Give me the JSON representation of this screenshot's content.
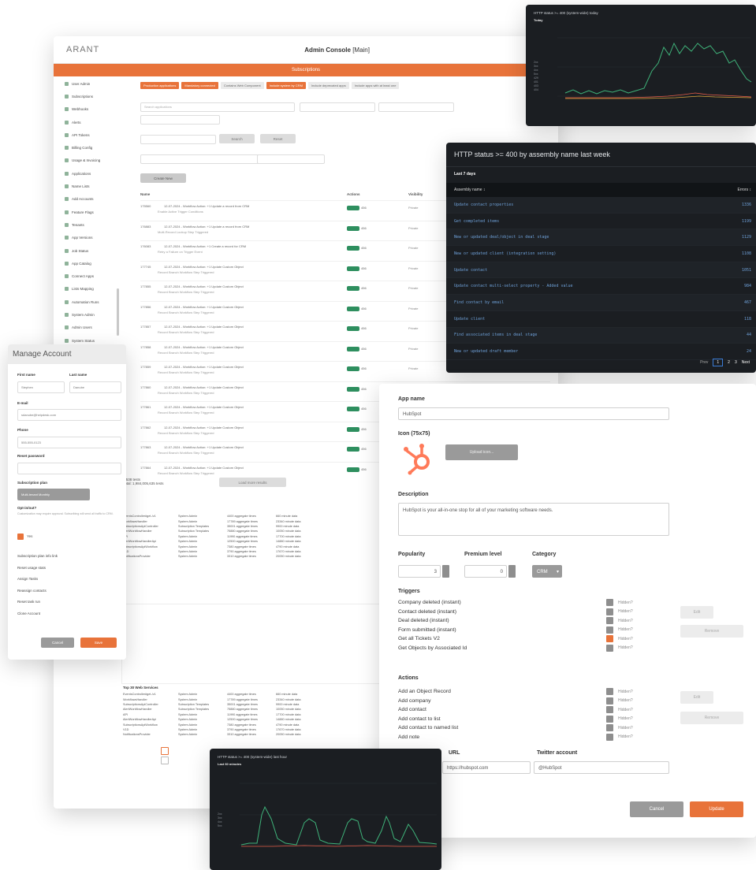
{
  "admin": {
    "brand": "ARANT",
    "title": "Admin Console",
    "title_suffix": "[Main]",
    "bar_label": "Subscriptions",
    "sidebar": [
      "User Admin",
      "Subscriptions",
      "Webhooks",
      "Alerts",
      "API Tokens",
      "Billing Config",
      "Usage & Invoicing",
      "Applications",
      "Name Lists",
      "Add Accounts",
      "Feature Flags",
      "Tenants",
      "App Versions",
      "Job Status",
      "App Catalog",
      "Connect Apps",
      "Lists Mapping",
      "Automation Runs",
      "System Admin",
      "Admin Users",
      "System Status"
    ],
    "chips": [
      "Production applications",
      "Mandatory connected",
      "Contains Web Component",
      "Include system by CRM",
      "Include deprecated apps",
      "Include apps with at least one"
    ],
    "search_placeholder": "Search applications",
    "buttons": {
      "search": "Search",
      "reset": "Reset",
      "create": "Create New"
    },
    "grid_headers": [
      "Name",
      "Actions",
      "Visibility"
    ],
    "rows": [
      {
        "t1": "175560",
        "t2": "12-07-2024 - Workflow Action: +1 Update a record from CRM",
        "t3": "Enable Active Trigger Conditions",
        "count": "456",
        "vis": "Private"
      },
      {
        "t1": "176883",
        "t2": "12-07-2024 - Workflow Action: +1 Update a record from CRM",
        "t3": "Multi-Record Lookup Step Triggered",
        "count": "456",
        "vis": "Private"
      },
      {
        "t1": "176083",
        "t2": "12-07-2024 - Workflow Action: +1 Create a record for CRM",
        "t3": "Retry a Failure on Trigger Event",
        "count": "456",
        "vis": "Private"
      },
      {
        "t1": "177745",
        "t2": "12-07-2024 - Workflow Action: +1 Update Custom Object",
        "t3": "Record Branch Workflow Step Triggered",
        "count": "456",
        "vis": "Private"
      },
      {
        "t1": "177855",
        "t2": "12-07-2024 - Workflow Action: +1 Update Custom Object",
        "t3": "Record Branch Workflow Step Triggered",
        "count": "456",
        "vis": "Private"
      },
      {
        "t1": "177856",
        "t2": "12-07-2024 - Workflow Action: +1 Update Custom Object",
        "t3": "Record Branch Workflow Step Triggered",
        "count": "456",
        "vis": "Private"
      },
      {
        "t1": "177857",
        "t2": "12-07-2024 - Workflow Action: +1 Update Custom Object",
        "t3": "Record Branch Workflow Step Triggered",
        "count": "456",
        "vis": "Private"
      },
      {
        "t1": "177858",
        "t2": "12-07-2024 - Workflow Action: +1 Update Custom Object",
        "t3": "Record Branch Workflow Step Triggered",
        "count": "456",
        "vis": "Private"
      },
      {
        "t1": "177859",
        "t2": "12-07-2024 - Workflow Action: +1 Update Custom Object",
        "t3": "Record Branch Workflow Step Triggered",
        "count": "456",
        "vis": "Private"
      },
      {
        "t1": "177860",
        "t2": "12-07-2024 - Workflow Action: +1 Update Custom Object",
        "t3": "Record Branch Workflow Step Triggered",
        "count": "456",
        "vis": "Private"
      },
      {
        "t1": "177861",
        "t2": "12-07-2024 - Workflow Action: +1 Update Custom Object",
        "t3": "Record Branch Workflow Step Triggered",
        "count": "456",
        "vis": "Private"
      },
      {
        "t1": "177862",
        "t2": "12-07-2024 - Workflow Action: +1 Update Custom Object",
        "t3": "Record Branch Workflow Step Triggered",
        "count": "456",
        "vis": "Private"
      },
      {
        "t1": "177863",
        "t2": "12-07-2024 - Workflow Action: +1 Update Custom Object",
        "t3": "Record Branch Workflow Step Triggered",
        "count": "456",
        "vis": "Private"
      },
      {
        "t1": "177864",
        "t2": "12-07-2024 - Workflow Action: +1 Update Custom Object",
        "t3": "Record Branch Workflow Step Triggered",
        "count": "456",
        "vis": "Private"
      }
    ],
    "stats_line1": "2,538 tests",
    "stats_line2": "Total: 1,984,005,635 tests",
    "stats_button": "Load more results",
    "top_title": "Top 30 Web Services",
    "top_rows": [
      [
        "EventsController#get-/v1",
        "System Admin",
        "4400 aggregate times",
        "660 minute data"
      ],
      [
        "WorkflowsHandler",
        "System Admin",
        "17789 aggregate times",
        "23340 minute data"
      ],
      [
        "SubscriptionsApiController",
        "Subscription Templates",
        "35001 aggregate times",
        "9900 minute data"
      ],
      [
        "AlertWorkflowHandler",
        "Subscription Templates",
        "75880 aggregate times",
        "10050 minute data"
      ],
      [
        "API",
        "System Admin",
        "11990 aggregate times",
        "17700 minute data"
      ],
      [
        "AlertWorkflowHandlerApi",
        "System Admin",
        "12500 aggregate times",
        "14880 minute data"
      ],
      [
        "SubscriptionsApiWorkflow",
        "System Admin",
        "7380 aggregate times",
        "4790 minute data"
      ],
      [
        "V1D",
        "System Admin",
        "3790 aggregate times",
        "17670 minute data"
      ],
      [
        "NotificationsProvider",
        "System Admin",
        "3310 aggregate times",
        "20050 minute data"
      ]
    ]
  },
  "manage": {
    "title": "Manage Account",
    "first_name_label": "First name",
    "first_name": "Stephen",
    "last_name_label": "Last name",
    "last_name": "Danube",
    "email_label": "E-mail",
    "email": "sdanube@helpdesk.com",
    "phone_label": "Phone",
    "phone": "555-555-0123",
    "password_label": "Reset password",
    "plan_label": "Subscription plan",
    "plan_value": "Multi-tenant Monthly",
    "optin_label": "Opt-in/out?",
    "optin_help": "Customization may require approval. Subscribing will send all traffic to CRM.",
    "yes": "Yes",
    "links": [
      "Subscription plan info link",
      "Reset usage stats",
      "Assign Tasks",
      "Reassign contacts",
      "Reset task run",
      "Clone Account"
    ],
    "cancel": "Cancel",
    "save": "Save"
  },
  "graph1": {
    "title": "HTTP status >= 400 (system-wide) today",
    "subtitle": "Today",
    "legend": [
      "2xx",
      "3xx",
      "4xx",
      "5xx",
      "429",
      "401",
      "403",
      "404"
    ],
    "colors": {
      "a": "#3fb37a",
      "b": "#e55d4a",
      "c": "#d8a13a",
      "d": "#7a8fe0"
    }
  },
  "graph2": {
    "title": "HTTP status >= 400 (system-wide) last hour",
    "subtitle": "Last 60 minutes",
    "legend": [
      "2xx",
      "3xx",
      "4xx",
      "5xx"
    ],
    "colors": {
      "a": "#3fb37a",
      "b": "#e55d4a",
      "c": "#d8a13a",
      "d": "#7a8fe0"
    }
  },
  "http": {
    "title": "HTTP status >= 400 by assembly name last week",
    "subtitle": "Last 7 days",
    "col_name": "Assembly name",
    "col_errors": "Errors",
    "rows": [
      {
        "name": "Update contact properties",
        "count": "1336"
      },
      {
        "name": "Get completed items",
        "count": "1199"
      },
      {
        "name": "New or updated deal/object in deal stage",
        "count": "1129"
      },
      {
        "name": "New or updated client (integration setting)",
        "count": "1108"
      },
      {
        "name": "Update contact",
        "count": "1051"
      },
      {
        "name": "Update contact multi-select property - Added value",
        "count": "984"
      },
      {
        "name": "Find contact by email",
        "count": "467"
      },
      {
        "name": "Update client",
        "count": "118"
      },
      {
        "name": "Find associated items in deal stage",
        "count": "44"
      },
      {
        "name": "New or updated draft member",
        "count": "24"
      }
    ],
    "pager": {
      "prev": "Prev",
      "p1": "1",
      "p2": "2",
      "p3": "3",
      "next": "Next"
    }
  },
  "app": {
    "name_label": "App name",
    "name_value": "HubSpot",
    "icon_label": "Icon (75x75)",
    "upload_button": "Upload icon...",
    "desc_label": "Description",
    "desc_value": "HubSpot is your all-in-one stop for all of your marketing software needs.",
    "popularity_label": "Popularity",
    "popularity_value": "3",
    "premium_label": "Premium level",
    "premium_value": "0",
    "category_label": "Category",
    "category_value": "CRM",
    "triggers_label": "Triggers",
    "triggers": [
      "Company deleted (instant)",
      "Contact deleted (instant)",
      "Deal deleted (instant)",
      "Form submitted (instant)",
      "Get all Tickets V2",
      "Get Objects by Associated Id"
    ],
    "actions_label": "Actions",
    "actions": [
      "Add an Object Record",
      "Add company",
      "Add contact",
      "Add contact to list",
      "Add contact to named list",
      "Add note"
    ],
    "hidden_label": "Hidden?",
    "edit": "Edit",
    "remove": "Remove",
    "url_label": "URL",
    "url_value": "https://hubspot.com",
    "twitter_label": "Twitter account",
    "twitter_value": "@HubSpot",
    "cancel": "Cancel",
    "update": "Update",
    "brand_color": "#ff7a59"
  }
}
